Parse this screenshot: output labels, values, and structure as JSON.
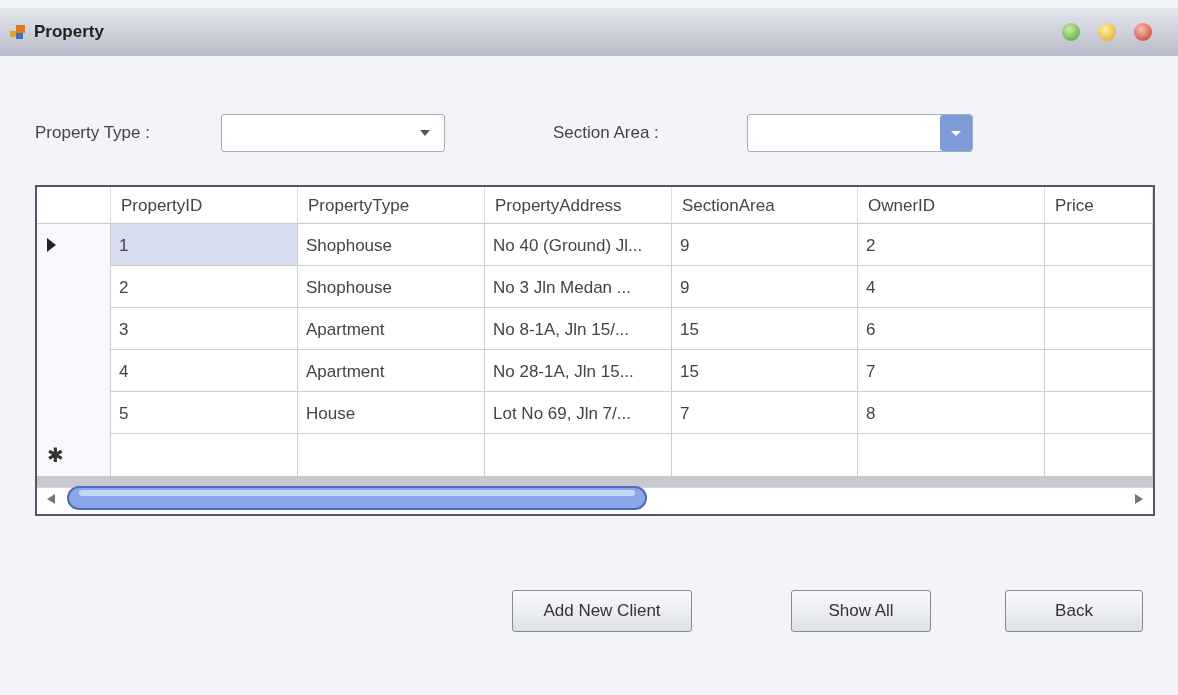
{
  "window": {
    "title": "Property"
  },
  "filters": [
    {
      "label": "Property Type :"
    },
    {
      "label": "Section Area :"
    }
  ],
  "table": {
    "columns": [
      "PropertyID",
      "PropertyType",
      "PropertyAddress",
      "SectionArea",
      "OwnerID",
      "Price"
    ],
    "rows": [
      {
        "current": true,
        "selected": true,
        "cells": [
          "1",
          "Shophouse",
          "No 40 (Ground) Jl...",
          "9",
          "2",
          ""
        ]
      },
      {
        "current": false,
        "selected": false,
        "cells": [
          "2",
          "Shophouse",
          "No 3 Jln Medan ...",
          "9",
          "4",
          ""
        ]
      },
      {
        "current": false,
        "selected": false,
        "cells": [
          "3",
          "Apartment",
          "No 8-1A, Jln 15/...",
          "15",
          "6",
          ""
        ]
      },
      {
        "current": false,
        "selected": false,
        "cells": [
          "4",
          "Apartment",
          "No 28-1A, Jln 15...",
          "15",
          "7",
          ""
        ]
      },
      {
        "current": false,
        "selected": false,
        "cells": [
          "5",
          "House",
          "Lot No 69, Jln 7/...",
          "7",
          "8",
          ""
        ]
      }
    ],
    "new_row_marker": "✱"
  },
  "buttons": [
    "Add New Client",
    "Show All",
    "Back"
  ]
}
